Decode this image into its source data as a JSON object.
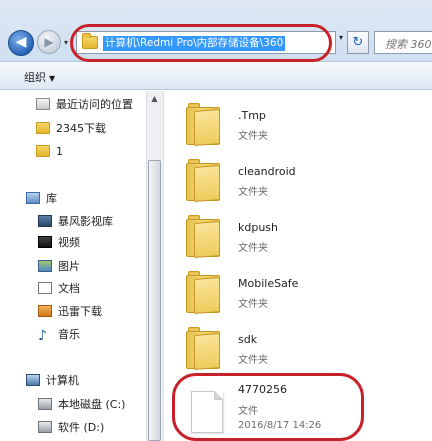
{
  "nav": {
    "back_glyph": "◀",
    "forward_glyph": "▶",
    "history_glyph": "▾",
    "address": "计算机\\Redmi Pro\\内部存储设备\\360",
    "address_dropdown_glyph": "▾",
    "refresh_glyph": "↻",
    "search_placeholder": "搜索 360"
  },
  "toolbar": {
    "organize_label": "组织",
    "organize_arrow": "▼"
  },
  "sidebar": {
    "items": [
      {
        "label": "最近访问的位置",
        "icon": "recent-places-icon"
      },
      {
        "label": "2345下载",
        "icon": "folder-icon"
      },
      {
        "label": "1",
        "icon": "folder-icon"
      },
      {
        "label": "库",
        "icon": "library-icon"
      },
      {
        "label": "暴风影视库",
        "icon": "video-library-icon"
      },
      {
        "label": "视频",
        "icon": "film-icon"
      },
      {
        "label": "图片",
        "icon": "pictures-icon"
      },
      {
        "label": "文档",
        "icon": "documents-icon"
      },
      {
        "label": "迅雷下载",
        "icon": "download-icon"
      },
      {
        "label": "音乐",
        "icon": "music-icon"
      },
      {
        "label": "计算机",
        "icon": "computer-icon"
      },
      {
        "label": "本地磁盘 (C:)",
        "icon": "local-disk-icon"
      },
      {
        "label": "软件 (D:)",
        "icon": "drive-icon"
      }
    ],
    "scroll_up_glyph": "▲"
  },
  "files": [
    {
      "name": ".Tmp",
      "type": "文件夹"
    },
    {
      "name": "cleandroid",
      "type": "文件夹"
    },
    {
      "name": "kdpush",
      "type": "文件夹"
    },
    {
      "name": "MobileSafe",
      "type": "文件夹"
    },
    {
      "name": "sdk",
      "type": "文件夹"
    },
    {
      "name": "4770256",
      "type": "文件",
      "date": "2016/8/17 14:26"
    }
  ],
  "colors": {
    "highlight": "#c7222a",
    "address_selection": "#3399ff"
  }
}
